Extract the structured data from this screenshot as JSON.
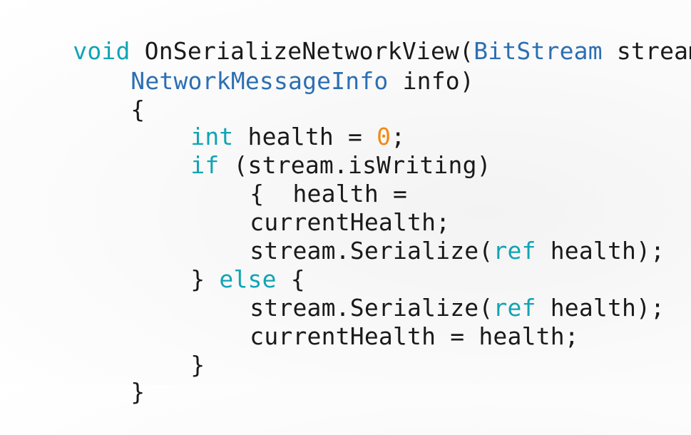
{
  "code": {
    "lines": [
      {
        "tokens": [
          {
            "text": "void",
            "kind": "keyword"
          },
          {
            "text": " OnSerializeNetworkView(",
            "kind": "plain"
          },
          {
            "text": "BitStream",
            "kind": "type"
          },
          {
            "text": " stream,",
            "kind": "plain"
          }
        ]
      },
      {
        "tokens": [
          {
            "text": "NetworkMessageInfo",
            "kind": "type"
          },
          {
            "text": " info)",
            "kind": "plain"
          }
        ]
      },
      {
        "tokens": [
          {
            "text": "{",
            "kind": "plain"
          }
        ]
      },
      {
        "tokens": [
          {
            "text": "int",
            "kind": "keyword"
          },
          {
            "text": " health = ",
            "kind": "plain"
          },
          {
            "text": "0",
            "kind": "number"
          },
          {
            "text": ";",
            "kind": "plain"
          }
        ]
      },
      {
        "tokens": [
          {
            "text": "if",
            "kind": "keyword"
          },
          {
            "text": " (stream.isWriting)",
            "kind": "plain"
          }
        ]
      },
      {
        "tokens": [
          {
            "text": "{  health =",
            "kind": "plain"
          }
        ]
      },
      {
        "tokens": [
          {
            "text": "currentHealth;",
            "kind": "plain"
          }
        ]
      },
      {
        "tokens": [
          {
            "text": "stream.Serialize(",
            "kind": "plain"
          },
          {
            "text": "ref",
            "kind": "keyword"
          },
          {
            "text": " health);",
            "kind": "plain"
          }
        ]
      },
      {
        "tokens": [
          {
            "text": "} ",
            "kind": "plain"
          },
          {
            "text": "else",
            "kind": "keyword"
          },
          {
            "text": " {",
            "kind": "plain"
          }
        ]
      },
      {
        "tokens": [
          {
            "text": "stream.Serialize(",
            "kind": "plain"
          },
          {
            "text": "ref",
            "kind": "keyword"
          },
          {
            "text": " health);",
            "kind": "plain"
          }
        ]
      },
      {
        "tokens": [
          {
            "text": "currentHealth = health;",
            "kind": "plain"
          }
        ]
      },
      {
        "tokens": [
          {
            "text": "}",
            "kind": "plain"
          }
        ]
      },
      {
        "tokens": [
          {
            "text": "}",
            "kind": "plain"
          }
        ]
      }
    ]
  },
  "colors": {
    "keyword": "#11a4b4",
    "type": "#2c6fb3",
    "number": "#f28a13",
    "plain": "#1a1a1a"
  }
}
